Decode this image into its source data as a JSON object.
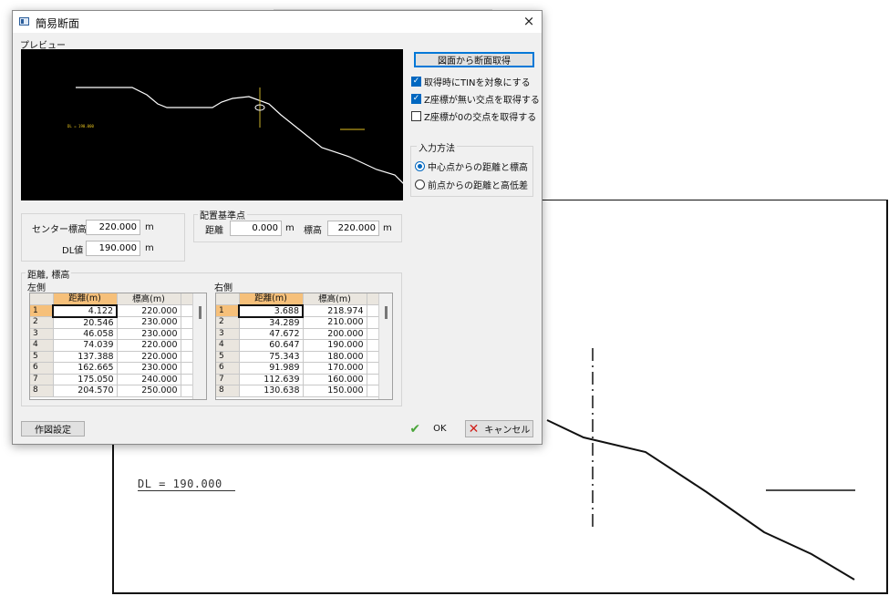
{
  "background": {
    "dl_text": "DL = 190.000"
  },
  "dialog": {
    "title": "簡易断面",
    "close_glyph": "×",
    "preview_label": "プレビュー",
    "preview_dl_text": "DL = 190.000",
    "get_section_button": "図面から断面取得",
    "options": [
      {
        "label": "取得時にTINを対象にする",
        "checked": true
      },
      {
        "label": "Z座標が無い交点を取得する",
        "checked": true
      },
      {
        "label": "Z座標が0の交点を取得する",
        "checked": false
      }
    ],
    "input_method": {
      "title": "入力方法",
      "options": [
        {
          "label": "中心点からの距離と標高",
          "selected": true
        },
        {
          "label": "前点からの距離と高低差",
          "selected": false
        }
      ]
    },
    "center": {
      "elev_label": "センター標高",
      "elev_value": "220.000",
      "elev_unit": "m",
      "dl_label": "DL値",
      "dl_value": "190.000",
      "dl_unit": "m"
    },
    "reference": {
      "title": "配置基準点",
      "dist_label": "距離",
      "dist_value": "0.000",
      "dist_unit": "m",
      "elev_label": "標高",
      "elev_value": "220.000",
      "elev_unit": "m"
    },
    "dist_elev_title": "距離, 標高",
    "left_grid": {
      "title": "左側",
      "headers": [
        "距離(m)",
        "標高(m)"
      ],
      "rows": [
        [
          "1",
          "4.122",
          "220.000"
        ],
        [
          "2",
          "20.546",
          "230.000"
        ],
        [
          "3",
          "46.058",
          "230.000"
        ],
        [
          "4",
          "74.039",
          "220.000"
        ],
        [
          "5",
          "137.388",
          "220.000"
        ],
        [
          "6",
          "162.665",
          "230.000"
        ],
        [
          "7",
          "175.050",
          "240.000"
        ],
        [
          "8",
          "204.570",
          "250.000"
        ]
      ]
    },
    "right_grid": {
      "title": "右側",
      "headers": [
        "距離(m)",
        "標高(m)"
      ],
      "rows": [
        [
          "1",
          "3.688",
          "218.974"
        ],
        [
          "2",
          "34.289",
          "210.000"
        ],
        [
          "3",
          "47.672",
          "200.000"
        ],
        [
          "4",
          "60.647",
          "190.000"
        ],
        [
          "5",
          "75.343",
          "180.000"
        ],
        [
          "6",
          "91.989",
          "170.000"
        ],
        [
          "7",
          "112.639",
          "160.000"
        ],
        [
          "8",
          "130.638",
          "150.000"
        ]
      ]
    },
    "drawing_settings_button": "作図設定",
    "ok_button": "OK",
    "cancel_button": "キャンセル",
    "ok_icon": "check-icon",
    "cancel_icon": "x-icon"
  }
}
